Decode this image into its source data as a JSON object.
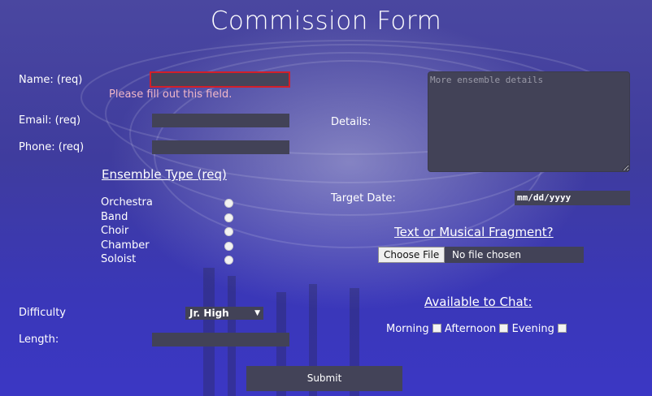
{
  "title": "Commission Form",
  "fields": {
    "name": {
      "label": "Name: (req)",
      "value": "",
      "error": "Please fill out this field."
    },
    "email": {
      "label": "Email: (req)",
      "value": ""
    },
    "phone": {
      "label": "Phone: (req)",
      "value": ""
    },
    "difficulty": {
      "label": "Difficulty",
      "selected": "Jr. High"
    },
    "length": {
      "label": "Length:",
      "value": ""
    },
    "details": {
      "label": "Details:",
      "placeholder": "More ensemble details"
    },
    "target_date": {
      "label": "Target Date:",
      "value": "mm/dd/yyyy"
    }
  },
  "ensemble": {
    "heading": "Ensemble Type (req)",
    "options": [
      "Orchestra",
      "Band",
      "Choir",
      "Chamber",
      "Soloist"
    ]
  },
  "fragment": {
    "heading": "Text or Musical Fragment?",
    "button": "Choose File",
    "status": "No file chosen"
  },
  "chat": {
    "heading": "Available to Chat:",
    "options": [
      "Morning",
      "Afternoon",
      "Evening"
    ]
  },
  "submit_label": "Submit",
  "icons": {
    "select_caret": "caret-down-icon"
  },
  "colors": {
    "field_bg": "#424257",
    "error_border": "#d21f2a",
    "error_text": "#f2b8c8"
  }
}
